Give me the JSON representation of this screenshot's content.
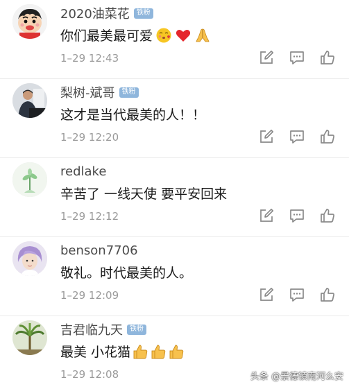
{
  "badge_label": "铁粉",
  "comments": [
    {
      "username": "2020油菜花",
      "has_badge": true,
      "text": "你们最美最可爱",
      "emoji": [
        "kissing-face-emoji",
        "red-heart-emoji",
        "folded-hands-emoji"
      ],
      "time": "1–29 12:43"
    },
    {
      "username": "梨树-斌哥",
      "has_badge": true,
      "text": "这才是当代最美的人！！",
      "emoji": [],
      "time": "1–29 12:20"
    },
    {
      "username": "redlake",
      "has_badge": false,
      "text": "辛苦了 一线天使 要平安回来",
      "emoji": [],
      "time": "1–29 12:12"
    },
    {
      "username": "benson7706",
      "has_badge": false,
      "text": "敬礼。时代最美的人。",
      "emoji": [],
      "time": "1–29 12:09"
    },
    {
      "username": "吉君临九天",
      "has_badge": true,
      "text": "最美 小花猫",
      "emoji": [
        "thumbs-up-emoji",
        "thumbs-up-emoji",
        "thumbs-up-emoji"
      ],
      "time": "1–29 12:08"
    }
  ],
  "watermark": "头条 @景德镇南河么安",
  "colors": {
    "badge": "#8fb6dc",
    "username": "#4a4a4a",
    "time": "#9a9a9a",
    "icon": "#8a8a8a"
  }
}
